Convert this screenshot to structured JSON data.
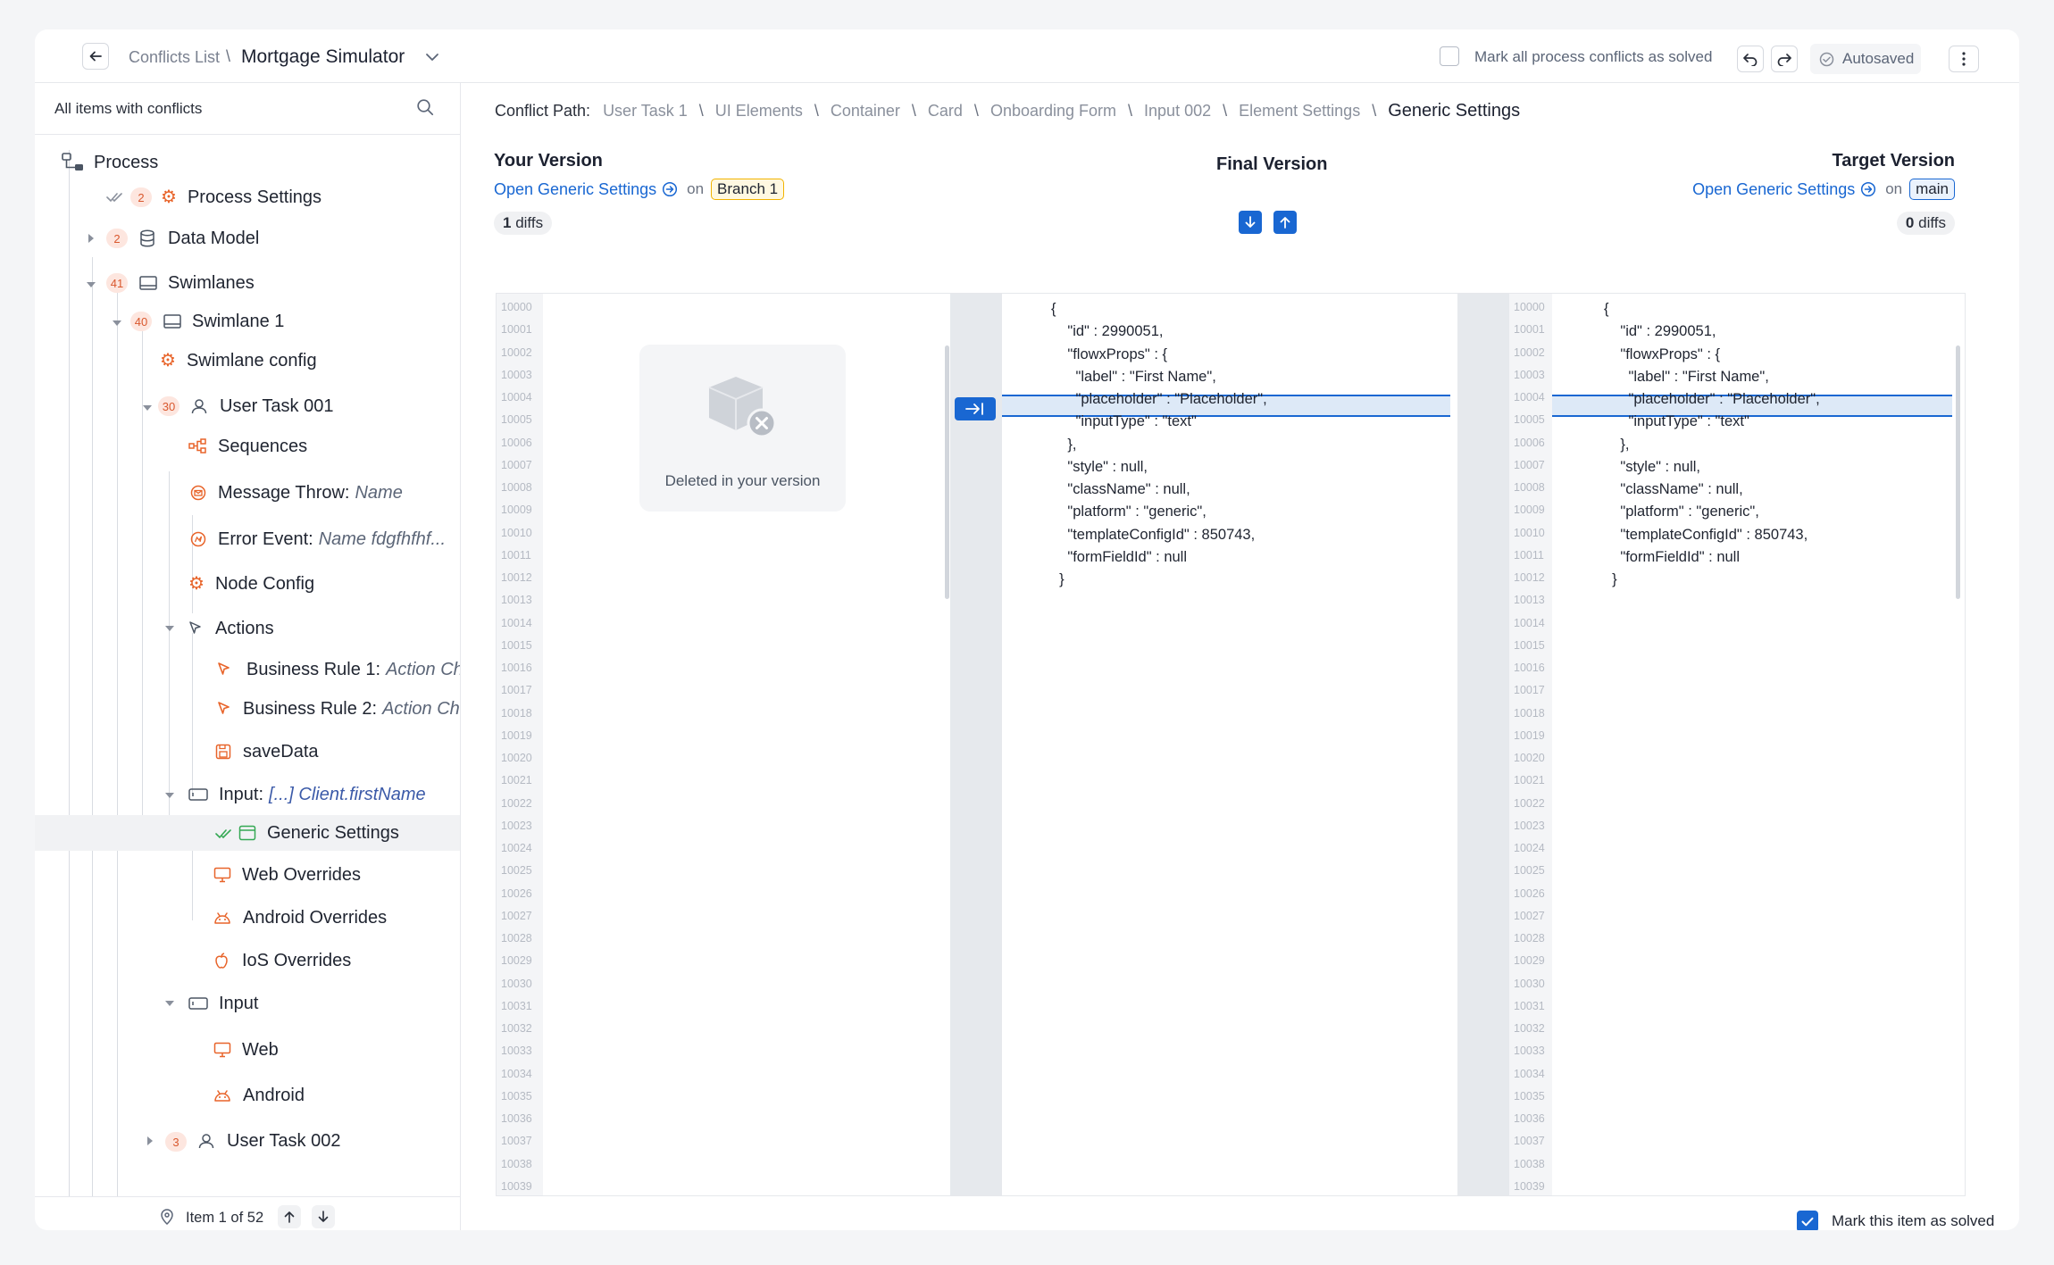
{
  "header": {
    "breadcrumb_parent": "Conflicts List",
    "breadcrumb_current": "Mortgage Simulator",
    "mark_all_label": "Mark all process conflicts as solved",
    "autosaved_label": "Autosaved"
  },
  "sidebar": {
    "search_label": "All items with conflicts",
    "tree": {
      "process": "Process",
      "process_settings": {
        "label": "Process Settings",
        "badge": "2"
      },
      "data_model": {
        "label": "Data Model",
        "badge": "2"
      },
      "swimlanes": {
        "label": "Swimlanes",
        "badge": "41"
      },
      "swimlane_1": {
        "label": "Swimlane 1",
        "badge": "40"
      },
      "swimlane_config": "Swimlane config",
      "user_task_001": {
        "label": "User Task 001",
        "badge": "30"
      },
      "sequences": "Sequences",
      "message_throw": {
        "label": "Message Throw:",
        "value": "Name"
      },
      "error_event": {
        "label": "Error Event:",
        "value": "Name fdgfhfhf..."
      },
      "node_config": "Node Config",
      "actions": "Actions",
      "business_rule_1": {
        "label": "Business Rule 1:",
        "value": "Action Che"
      },
      "business_rule_2": {
        "label": "Business Rule 2:",
        "value": "Action Che"
      },
      "save_data": "saveData",
      "input_1": {
        "label": "Input:",
        "value": "[...] Client.firstName"
      },
      "generic_settings": "Generic Settings",
      "web_overrides": "Web Overrides",
      "android_overrides": "Android Overrides",
      "ios_overrides": "IoS Overrides",
      "input_2": "Input",
      "web": "Web",
      "android": "Android",
      "user_task_002": {
        "label": "User Task 002",
        "badge": "3"
      }
    },
    "footer": {
      "item_counter": "Item 1 of 52"
    }
  },
  "main": {
    "conflict_path_label": "Conflict Path:",
    "path": [
      "User Task 1",
      "UI Elements",
      "Container",
      "Card",
      "Onboarding Form",
      "Input 002",
      "Element Settings"
    ],
    "path_current": "Generic Settings",
    "your_version": {
      "title": "Your Version",
      "link": "Open Generic Settings",
      "on": "on",
      "branch": "Branch 1",
      "diffs_count": "1",
      "diffs_word": "diffs",
      "deleted_text": "Deleted in your version"
    },
    "final_version": {
      "title": "Final Version"
    },
    "target_version": {
      "title": "Target Version",
      "link": "Open Generic Settings",
      "on": "on",
      "branch": "main",
      "diffs_count": "0",
      "diffs_word": "diffs"
    },
    "line_number_start": 10000,
    "line_count": 40,
    "highlight_line_index": 4,
    "code_lines": [
      "{",
      "    \"id\" : 2990051,",
      "    \"flowxProps\" : {",
      "      \"label\" : \"First Name\",",
      "      \"placeholder\" : \"Placeholder\",",
      "      \"inputType\" : \"text\"",
      "    },",
      "    \"style\" : null,",
      "    \"className\" : null,",
      "    \"platform\" : \"generic\",",
      "    \"templateConfigId\" : 850743,",
      "    \"formFieldId\" : null",
      "  }"
    ],
    "mark_item_label": "Mark this item as solved",
    "mark_item_checked": true,
    "colors": {
      "accent": "#1967d2",
      "conflict_badge": "#e8642a",
      "solved": "#34a853"
    }
  }
}
